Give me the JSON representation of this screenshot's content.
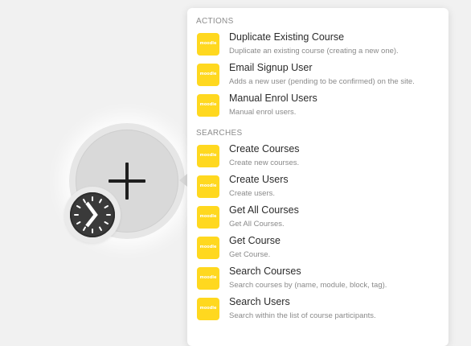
{
  "panel": {
    "sections": [
      {
        "header": "ACTIONS",
        "items": [
          {
            "title": "Duplicate Existing Course",
            "description": "Duplicate an existing course (creating a new one).",
            "logo_text": "moodle"
          },
          {
            "title": "Email Signup User",
            "description": "Adds a new user (pending to be confirmed) on the site.",
            "logo_text": "moodle"
          },
          {
            "title": "Manual Enrol Users",
            "description": "Manual enrol users.",
            "logo_text": "moodle"
          }
        ]
      },
      {
        "header": "SEARCHES",
        "items": [
          {
            "title": "Create Courses",
            "description": "Create new courses.",
            "logo_text": "moodle"
          },
          {
            "title": "Create Users",
            "description": "Create users.",
            "logo_text": "moodle"
          },
          {
            "title": "Get All Courses",
            "description": "Get All Courses.",
            "logo_text": "moodle"
          },
          {
            "title": "Get Course",
            "description": "Get Course.",
            "logo_text": "moodle"
          },
          {
            "title": "Search Courses",
            "description": "Search courses by (name, module, block, tag).",
            "logo_text": "moodle"
          },
          {
            "title": "Search Users",
            "description": "Search within the list of course participants.",
            "logo_text": "moodle"
          }
        ]
      }
    ]
  },
  "module": {
    "add_icon": "plus-icon",
    "trigger_icon": "clock-icon"
  },
  "colors": {
    "logo_bg": "#ffd81f",
    "panel_bg": "#ffffff",
    "canvas_bg": "#f1f1f1"
  }
}
